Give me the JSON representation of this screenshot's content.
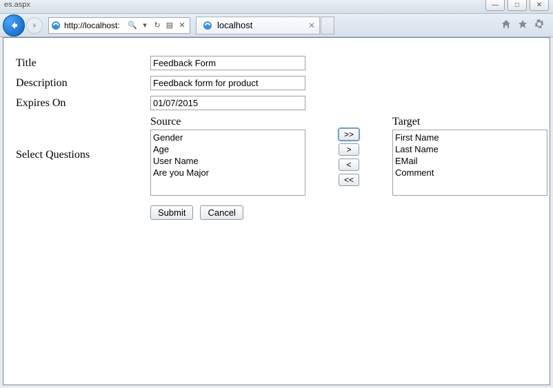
{
  "window": {
    "title_fragment": "es.aspx",
    "minimize": "—",
    "maximize": "□",
    "close": "✕"
  },
  "nav": {
    "url": "http://localhost:",
    "search_glyph": "🔍",
    "tab_title": "localhost"
  },
  "form": {
    "labels": {
      "title": "Title",
      "description": "Description",
      "expires": "Expires On",
      "select_questions": "Select Questions",
      "source": "Source",
      "target": "Target"
    },
    "values": {
      "title": "Feedback Form",
      "description": "Feedback form for product",
      "expires": "01/07/2015"
    },
    "source_items": [
      "Gender",
      "Age",
      "User Name",
      "Are you Major"
    ],
    "target_items": [
      "First Name",
      "Last Name",
      "EMail",
      "Comment"
    ],
    "buttons": {
      "all_right": ">>",
      "right": ">",
      "left": "<",
      "all_left": "<<",
      "submit": "Submit",
      "cancel": "Cancel"
    }
  }
}
